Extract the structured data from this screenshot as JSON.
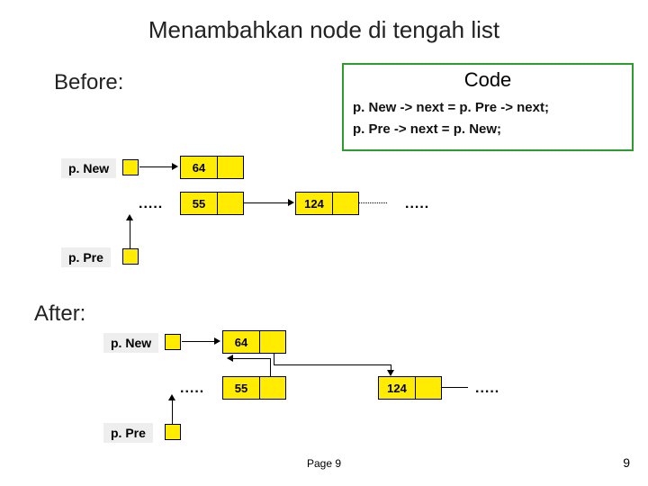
{
  "title": "Menambahkan node di tengah list",
  "before": "Before:",
  "after": "After:",
  "code": {
    "heading": "Code",
    "line1": "p. New -> next = p. Pre -> next;",
    "line2": "p. Pre -> next = p. New;"
  },
  "labels": {
    "pNew": "p. New",
    "pPre": "p. Pre"
  },
  "nodes": {
    "n64": "64",
    "n55": "55",
    "n124": "124"
  },
  "page": "Page 9",
  "slide": "9"
}
